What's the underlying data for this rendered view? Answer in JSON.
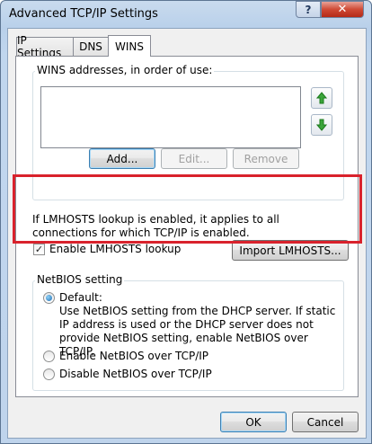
{
  "window": {
    "title": "Advanced TCP/IP Settings",
    "help_label": "?",
    "close_label": "✕"
  },
  "tabs": [
    {
      "label": "IP Settings",
      "active": false
    },
    {
      "label": "DNS",
      "active": false
    },
    {
      "label": "WINS",
      "active": true
    }
  ],
  "wins": {
    "group_label": "WINS addresses, in order of use:",
    "addresses": [],
    "up_icon": "arrow-up-icon",
    "down_icon": "arrow-down-icon",
    "buttons": {
      "add": "Add...",
      "edit": "Edit...",
      "remove": "Remove"
    }
  },
  "lmhosts": {
    "description": "If LMHOSTS lookup is enabled, it applies to all connections for which TCP/IP is enabled.",
    "enable_label": "Enable LMHOSTS lookup",
    "enable_checked": true,
    "import_label": "Import LMHOSTS..."
  },
  "netbios": {
    "group_label": "NetBIOS setting",
    "options": [
      {
        "label": "Default:",
        "checked": true,
        "description": "Use NetBIOS setting from the DHCP server. If static IP address is used or the DHCP server does not provide NetBIOS setting, enable NetBIOS over TCP/IP."
      },
      {
        "label": "Enable NetBIOS over TCP/IP",
        "checked": false
      },
      {
        "label": "Disable NetBIOS over TCP/IP",
        "checked": false
      }
    ]
  },
  "footer": {
    "ok_label": "OK",
    "cancel_label": "Cancel"
  },
  "colors": {
    "highlight": "#d9222c",
    "arrow_green": "#2e9b2e"
  }
}
